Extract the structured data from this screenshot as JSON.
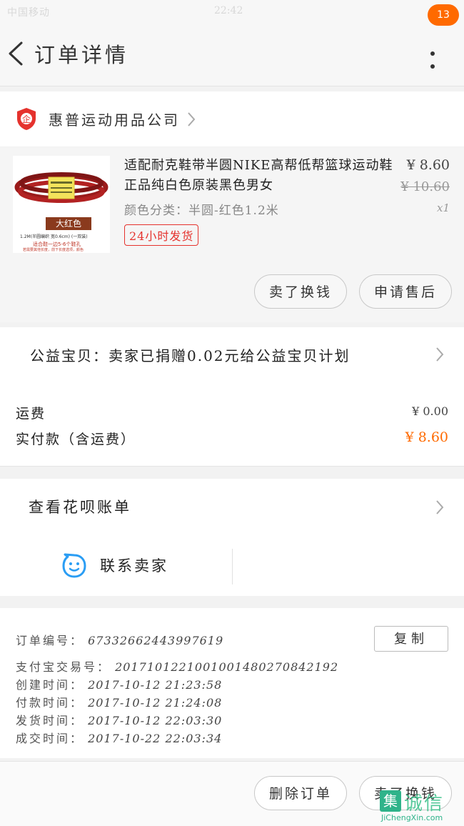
{
  "status_bar": {
    "carrier": "中国移动",
    "time": "22:42"
  },
  "header": {
    "title": "订单详情",
    "badge": "13"
  },
  "shop": {
    "name": "惠普运动用品公司",
    "logo_char": "企"
  },
  "product": {
    "title": "适配耐克鞋带半圆NIKE高帮低帮篮球运动鞋正品纯白色原装黑色男女",
    "sku": "颜色分类：半圆-红色1.2米",
    "ship_tag": "24小时发货",
    "price": "¥ 8.60",
    "original_price": "¥ 10.60",
    "quantity": "x1",
    "thumb": {
      "color_label": "大红色",
      "spec": "1.2M(半圆编织 宽0.6cm) (一双装)",
      "fit": "适合鞋一边5-6个鞋孔",
      "note": "若需要其他长度，前下长度选项，颜色"
    },
    "actions": {
      "exchange": "卖了换钱",
      "after_sales": "申请售后"
    }
  },
  "charity": {
    "text": "公益宝贝：卖家已捐赠0.02元给公益宝贝计划"
  },
  "fees": {
    "shipping_label": "运费",
    "shipping_value": "¥ 0.00",
    "paid_label": "实付款（含运费）",
    "paid_value": "¥ 8.60"
  },
  "huabei": {
    "label": "查看花呗账单"
  },
  "contact": {
    "label": "联系卖家"
  },
  "order_info": {
    "order_no_label": "订单编号：",
    "order_no": "673326624439976​19",
    "copy_label": "复制",
    "rows": [
      {
        "label": "支付宝交易号：",
        "value": "2017101221001001480270842192"
      },
      {
        "label": "创建时间：",
        "value": "2017-10-12  21:23:58"
      },
      {
        "label": "付款时间：",
        "value": "2017-10-12  21:24:08"
      },
      {
        "label": "发货时间：",
        "value": "2017-10-12  22:03:30"
      },
      {
        "label": "成交时间：",
        "value": "2017-10-22  22:03:34"
      }
    ]
  },
  "footer": {
    "delete": "删除订单",
    "exchange": "卖了换钱"
  },
  "watermark": {
    "logo_char": "集",
    "big": "诚信",
    "small": "JiChengXin.com"
  },
  "colors": {
    "accent": "#ff6a00",
    "shop_icon": "#e5322d",
    "contact_icon": "#2a9df4"
  }
}
